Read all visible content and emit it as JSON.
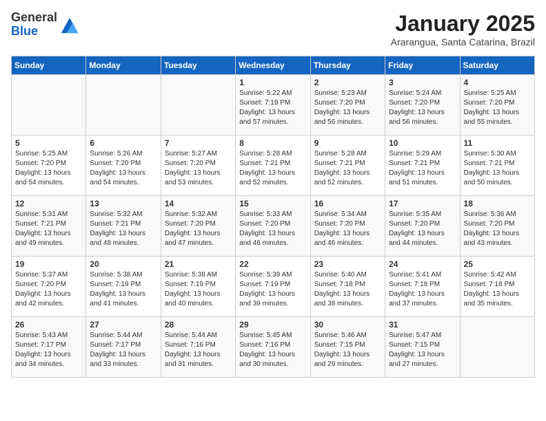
{
  "header": {
    "logo_general": "General",
    "logo_blue": "Blue",
    "month_title": "January 2025",
    "location": "Ararangua, Santa Catarina, Brazil"
  },
  "days_of_week": [
    "Sunday",
    "Monday",
    "Tuesday",
    "Wednesday",
    "Thursday",
    "Friday",
    "Saturday"
  ],
  "weeks": [
    [
      {
        "day": "",
        "info": ""
      },
      {
        "day": "",
        "info": ""
      },
      {
        "day": "",
        "info": ""
      },
      {
        "day": "1",
        "info": "Sunrise: 5:22 AM\nSunset: 7:19 PM\nDaylight: 13 hours\nand 57 minutes."
      },
      {
        "day": "2",
        "info": "Sunrise: 5:23 AM\nSunset: 7:20 PM\nDaylight: 13 hours\nand 56 minutes."
      },
      {
        "day": "3",
        "info": "Sunrise: 5:24 AM\nSunset: 7:20 PM\nDaylight: 13 hours\nand 56 minutes."
      },
      {
        "day": "4",
        "info": "Sunrise: 5:25 AM\nSunset: 7:20 PM\nDaylight: 13 hours\nand 55 minutes."
      }
    ],
    [
      {
        "day": "5",
        "info": "Sunrise: 5:25 AM\nSunset: 7:20 PM\nDaylight: 13 hours\nand 54 minutes."
      },
      {
        "day": "6",
        "info": "Sunrise: 5:26 AM\nSunset: 7:20 PM\nDaylight: 13 hours\nand 54 minutes."
      },
      {
        "day": "7",
        "info": "Sunrise: 5:27 AM\nSunset: 7:20 PM\nDaylight: 13 hours\nand 53 minutes."
      },
      {
        "day": "8",
        "info": "Sunrise: 5:28 AM\nSunset: 7:21 PM\nDaylight: 13 hours\nand 52 minutes."
      },
      {
        "day": "9",
        "info": "Sunrise: 5:28 AM\nSunset: 7:21 PM\nDaylight: 13 hours\nand 52 minutes."
      },
      {
        "day": "10",
        "info": "Sunrise: 5:29 AM\nSunset: 7:21 PM\nDaylight: 13 hours\nand 51 minutes."
      },
      {
        "day": "11",
        "info": "Sunrise: 5:30 AM\nSunset: 7:21 PM\nDaylight: 13 hours\nand 50 minutes."
      }
    ],
    [
      {
        "day": "12",
        "info": "Sunrise: 5:31 AM\nSunset: 7:21 PM\nDaylight: 13 hours\nand 49 minutes."
      },
      {
        "day": "13",
        "info": "Sunrise: 5:32 AM\nSunset: 7:21 PM\nDaylight: 13 hours\nand 48 minutes."
      },
      {
        "day": "14",
        "info": "Sunrise: 5:32 AM\nSunset: 7:20 PM\nDaylight: 13 hours\nand 47 minutes."
      },
      {
        "day": "15",
        "info": "Sunrise: 5:33 AM\nSunset: 7:20 PM\nDaylight: 13 hours\nand 46 minutes."
      },
      {
        "day": "16",
        "info": "Sunrise: 5:34 AM\nSunset: 7:20 PM\nDaylight: 13 hours\nand 46 minutes."
      },
      {
        "day": "17",
        "info": "Sunrise: 5:35 AM\nSunset: 7:20 PM\nDaylight: 13 hours\nand 44 minutes."
      },
      {
        "day": "18",
        "info": "Sunrise: 5:36 AM\nSunset: 7:20 PM\nDaylight: 13 hours\nand 43 minutes."
      }
    ],
    [
      {
        "day": "19",
        "info": "Sunrise: 5:37 AM\nSunset: 7:20 PM\nDaylight: 13 hours\nand 42 minutes."
      },
      {
        "day": "20",
        "info": "Sunrise: 5:38 AM\nSunset: 7:19 PM\nDaylight: 13 hours\nand 41 minutes."
      },
      {
        "day": "21",
        "info": "Sunrise: 5:38 AM\nSunset: 7:19 PM\nDaylight: 13 hours\nand 40 minutes."
      },
      {
        "day": "22",
        "info": "Sunrise: 5:39 AM\nSunset: 7:19 PM\nDaylight: 13 hours\nand 39 minutes."
      },
      {
        "day": "23",
        "info": "Sunrise: 5:40 AM\nSunset: 7:18 PM\nDaylight: 13 hours\nand 38 minutes."
      },
      {
        "day": "24",
        "info": "Sunrise: 5:41 AM\nSunset: 7:18 PM\nDaylight: 13 hours\nand 37 minutes."
      },
      {
        "day": "25",
        "info": "Sunrise: 5:42 AM\nSunset: 7:18 PM\nDaylight: 13 hours\nand 35 minutes."
      }
    ],
    [
      {
        "day": "26",
        "info": "Sunrise: 5:43 AM\nSunset: 7:17 PM\nDaylight: 13 hours\nand 34 minutes."
      },
      {
        "day": "27",
        "info": "Sunrise: 5:44 AM\nSunset: 7:17 PM\nDaylight: 13 hours\nand 33 minutes."
      },
      {
        "day": "28",
        "info": "Sunrise: 5:44 AM\nSunset: 7:16 PM\nDaylight: 13 hours\nand 31 minutes."
      },
      {
        "day": "29",
        "info": "Sunrise: 5:45 AM\nSunset: 7:16 PM\nDaylight: 13 hours\nand 30 minutes."
      },
      {
        "day": "30",
        "info": "Sunrise: 5:46 AM\nSunset: 7:15 PM\nDaylight: 13 hours\nand 29 minutes."
      },
      {
        "day": "31",
        "info": "Sunrise: 5:47 AM\nSunset: 7:15 PM\nDaylight: 13 hours\nand 27 minutes."
      },
      {
        "day": "",
        "info": ""
      }
    ]
  ]
}
